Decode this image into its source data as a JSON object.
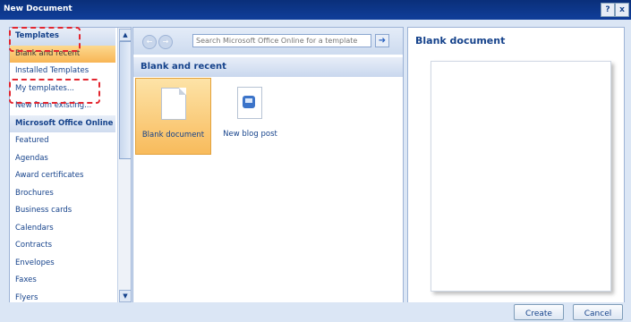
{
  "window": {
    "title": "New Document",
    "help_label": "?",
    "close_label": "x"
  },
  "sidebar": {
    "items": [
      {
        "label": "Templates",
        "kind": "group"
      },
      {
        "label": "Blank and recent",
        "kind": "selected"
      },
      {
        "label": "Installed Templates",
        "kind": "item"
      },
      {
        "label": "My templates...",
        "kind": "item"
      },
      {
        "label": "New from existing...",
        "kind": "item"
      },
      {
        "label": "Microsoft Office Online",
        "kind": "group"
      },
      {
        "label": "Featured",
        "kind": "item"
      },
      {
        "label": "Agendas",
        "kind": "item"
      },
      {
        "label": "Award certificates",
        "kind": "item"
      },
      {
        "label": "Brochures",
        "kind": "item"
      },
      {
        "label": "Business cards",
        "kind": "item"
      },
      {
        "label": "Calendars",
        "kind": "item"
      },
      {
        "label": "Contracts",
        "kind": "item"
      },
      {
        "label": "Envelopes",
        "kind": "item"
      },
      {
        "label": "Faxes",
        "kind": "item"
      },
      {
        "label": "Flyers",
        "kind": "item"
      }
    ]
  },
  "center": {
    "search_placeholder": "Search Microsoft Office Online for a template",
    "section_title": "Blank and recent",
    "tiles": [
      {
        "label": "Blank document",
        "icon": "blank-document-icon",
        "selected": true
      },
      {
        "label": "New blog post",
        "icon": "blog-post-icon",
        "selected": false
      }
    ]
  },
  "preview": {
    "title": "Blank document"
  },
  "footer": {
    "create_label": "Create",
    "cancel_label": "Cancel"
  },
  "colors": {
    "title_bar": "#0a2f7a",
    "accent_text": "#15428b",
    "selection": "#f8b555",
    "annotation": "#e3262f"
  }
}
